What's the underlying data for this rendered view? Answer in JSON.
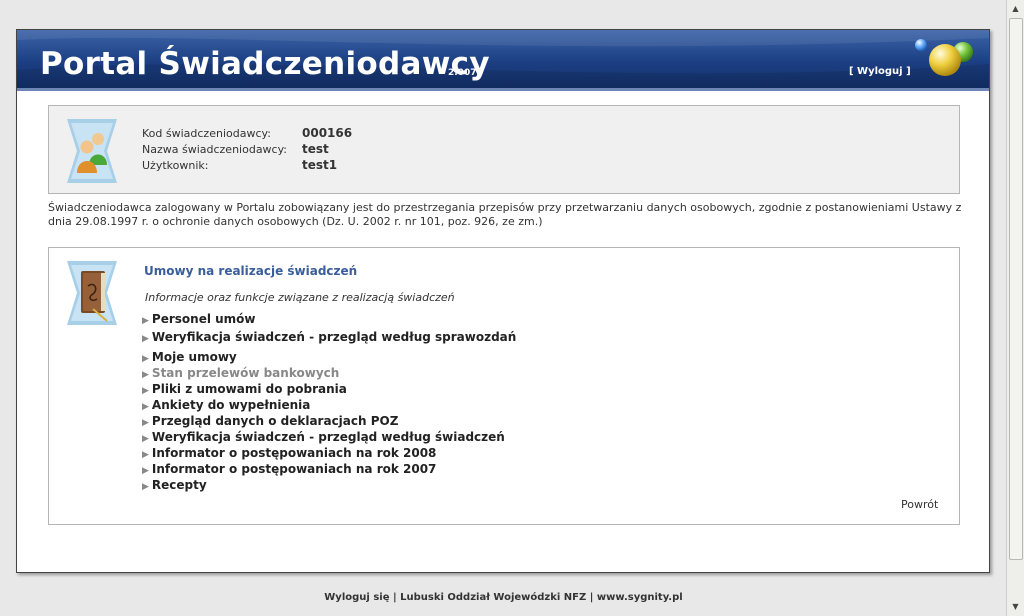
{
  "header": {
    "title": "Portal Świadczeniodawcy",
    "version": "2.0075",
    "logout": "[ Wyloguj ]"
  },
  "info": {
    "code_label": "Kod świadczeniodawcy:",
    "code_value": "000166",
    "name_label": "Nazwa świadczeniodawcy:",
    "name_value": "test",
    "user_label": "Użytkownik:",
    "user_value": "test1"
  },
  "notice_line1": "Świadczeniodawca zalogowany w Portalu zobowiązany jest do przestrzegania przepisów przy przetwarzaniu danych osobowych, zgodnie z postanowieniami Ustawy z",
  "notice_line2": "dnia 29.08.1997 r. o ochronie danych osobowych (Dz. U. 2002 r. nr 101, poz. 926, ze zm.)",
  "section": {
    "title": "Umowy na realizacje świadczeń",
    "subtitle": "Informacje oraz funkcje związane z realizacją świadczeń",
    "items": [
      {
        "label": "Personel umów"
      },
      {
        "label": "Weryfikacja świadczeń - przegląd według sprawozdań"
      },
      {
        "label": "Moje umowy"
      },
      {
        "label": "Stan przelewów bankowych"
      },
      {
        "label": "Pliki z umowami do pobrania"
      },
      {
        "label": "Ankiety do wypełnienia"
      },
      {
        "label": "Przegląd danych o deklaracjach POZ"
      },
      {
        "label": "Weryfikacja świadczeń - przegląd według świadczeń"
      },
      {
        "label": "Informator o postępowaniach na rok 2008"
      },
      {
        "label": "Informator o postępowaniach na rok 2007"
      },
      {
        "label": "Recepty"
      }
    ],
    "back": "Powrót"
  },
  "footer": {
    "logout": "Wyloguj się",
    "sep1": " | ",
    "org": "Lubuski Oddział Wojewódzki NFZ",
    "sep2": " | ",
    "site": "www.sygnity.pl"
  },
  "icons": {
    "users": "users-icon",
    "book": "book-icon",
    "balls": "decorative-balls-icon"
  },
  "colors": {
    "header": "#1c3f83",
    "section_title": "#3a5e9a"
  }
}
